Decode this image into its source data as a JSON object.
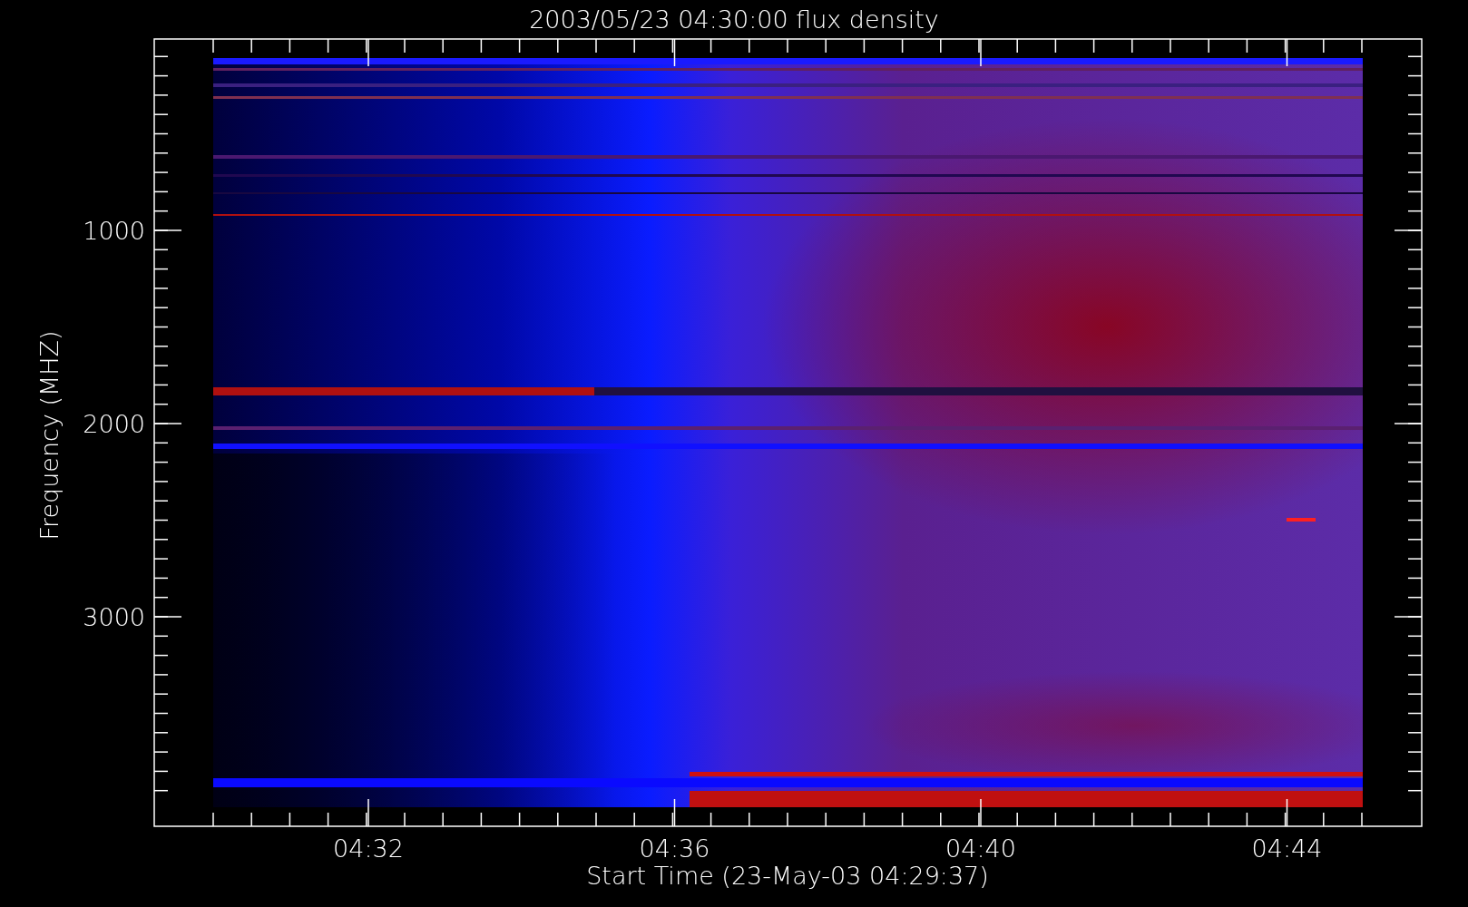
{
  "title": "2003/05/23 04:30:00 flux density",
  "y_axis": {
    "label": "Frequency (MHZ)",
    "ticks": [
      "1000",
      "2000",
      "3000"
    ]
  },
  "x_axis": {
    "label": "Start Time (23-May-03 04:29:37)",
    "ticks": [
      "04:32",
      "04:36",
      "04:40",
      "04:44"
    ]
  }
}
